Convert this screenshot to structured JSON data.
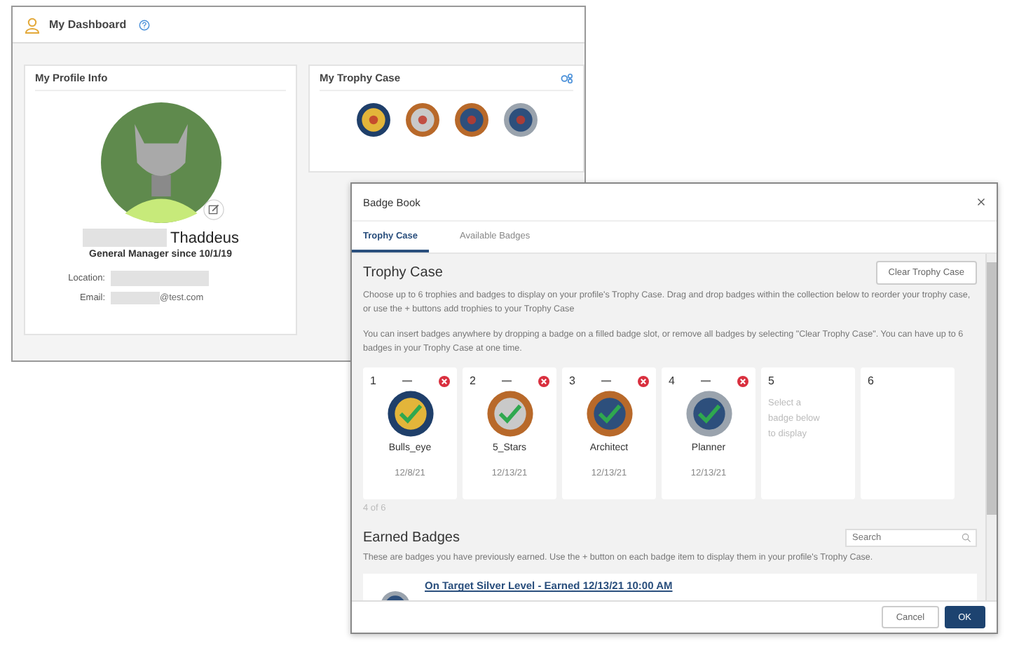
{
  "dashboard": {
    "title": "My Dashboard",
    "profile": {
      "heading": "My Profile Info",
      "name": "Thaddeus",
      "role": "General Manager since 10/1/19",
      "fields": [
        {
          "label": "Location:"
        },
        {
          "label": "Email:",
          "value": "@test.com"
        }
      ]
    },
    "trophy_card": {
      "heading": "My Trophy Case",
      "badges": [
        {
          "kind": "bullseye"
        },
        {
          "kind": "stars"
        },
        {
          "kind": "architect"
        },
        {
          "kind": "planner"
        }
      ]
    }
  },
  "dialog": {
    "title": "Badge Book",
    "tabs": [
      {
        "label": "Trophy Case",
        "selected": true
      },
      {
        "label": "Available Badges",
        "selected": false
      }
    ],
    "section_title": "Trophy Case",
    "clear_button": "Clear Trophy Case",
    "paragraphs": [
      "Choose up to 6 trophies and badges to display on your profile's Trophy Case. Drag and drop badges within the collection below to reorder your trophy case, or use the + buttons add trophies to your Trophy Case",
      "You can insert badges anywhere by dropping a badge on a filled badge slot, or remove all badges by selecting \"Clear Trophy Case\". You can have up to 6 badges in your Trophy Case at one time."
    ],
    "slots": [
      {
        "kind": "badge",
        "number": "1",
        "icon": {
          "kind": "bullseye"
        },
        "name": "Bulls_eye",
        "date": "12/8/21"
      },
      {
        "kind": "badge",
        "number": "2",
        "icon": {
          "kind": "stars"
        },
        "name": "5_Stars",
        "date": "12/13/21"
      },
      {
        "kind": "badge",
        "number": "3",
        "icon": {
          "kind": "architect"
        },
        "name": "Architect",
        "date": "12/13/21"
      },
      {
        "kind": "badge",
        "number": "4",
        "icon": {
          "kind": "planner"
        },
        "name": "Planner",
        "date": "12/13/21"
      },
      {
        "kind": "empty",
        "number": "5",
        "hint": "Select a badge below to display"
      },
      {
        "kind": "empty",
        "number": "6"
      }
    ],
    "count": "4 of 6",
    "earned": {
      "title": "Earned Badges",
      "search": {
        "placeholder": "Search"
      },
      "description": "These are badges you have previously earned. Use the + button on each badge item to display them in your profile's Trophy Case.",
      "items": [
        {
          "title": "On Target Silver Level - Earned 12/13/21 10:00 AM"
        }
      ]
    },
    "buttons": [
      {
        "label": "Cancel",
        "kind": "secondary"
      },
      {
        "label": "OK",
        "kind": "primary"
      }
    ]
  }
}
